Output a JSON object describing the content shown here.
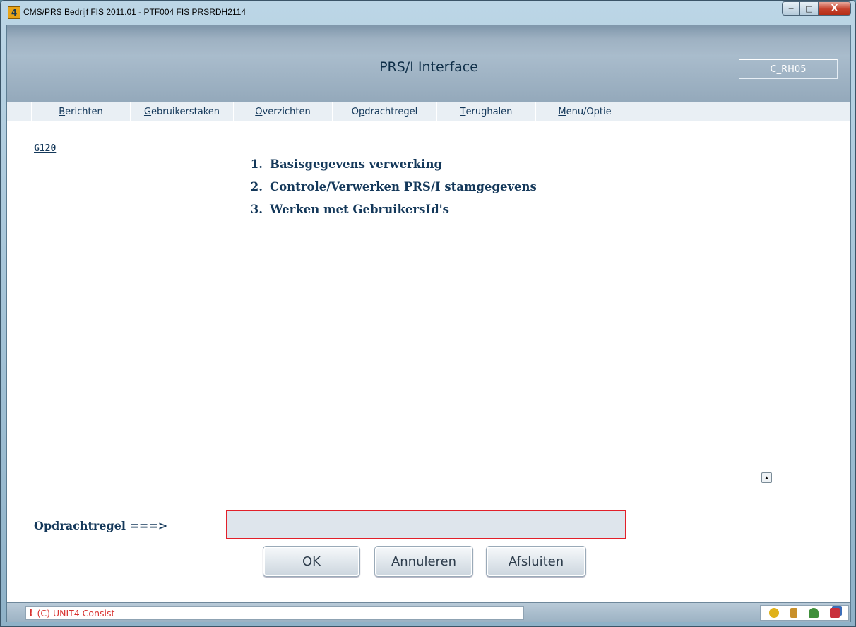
{
  "window": {
    "title": "CMS/PRS  Bedrijf FIS 2011.01  - PTF004 FIS PRSRDH2114",
    "app_icon_glyph": "4",
    "minimize_label": "─",
    "maximize_label": "□",
    "close_label": "X"
  },
  "header": {
    "title": "PRS/I Interface",
    "screen_code": "C_RH05"
  },
  "menu": {
    "items": [
      {
        "prefix": "",
        "accel": "B",
        "rest": "erichten"
      },
      {
        "prefix": "",
        "accel": "G",
        "rest": "ebruikerstaken"
      },
      {
        "prefix": "",
        "accel": "O",
        "rest": "verzichten"
      },
      {
        "prefix": "O",
        "accel": "p",
        "rest": "drachtregel"
      },
      {
        "prefix": "",
        "accel": "T",
        "rest": "erughalen"
      },
      {
        "prefix": "",
        "accel": "M",
        "rest": "enu/Optie"
      }
    ]
  },
  "main": {
    "screen_id": "G120",
    "options": [
      {
        "num": "1.",
        "label": "Basisgegevens verwerking"
      },
      {
        "num": "2.",
        "label": "Controle/Verwerken PRS/I stamgegevens"
      },
      {
        "num": "3.",
        "label": "Werken met GebruikersId's"
      }
    ],
    "scroll_up_glyph": "▲"
  },
  "command": {
    "label": "Opdrachtregel ===>",
    "value": "",
    "placeholder": ""
  },
  "buttons": {
    "ok": "OK",
    "cancel": "Annuleren",
    "close": "Afsluiten"
  },
  "status": {
    "indicator": "!",
    "message": "(C) UNIT4 Consist"
  },
  "colors": {
    "accent": "#14385a",
    "error_border": "#e2202a",
    "status_text": "#d8322f"
  }
}
